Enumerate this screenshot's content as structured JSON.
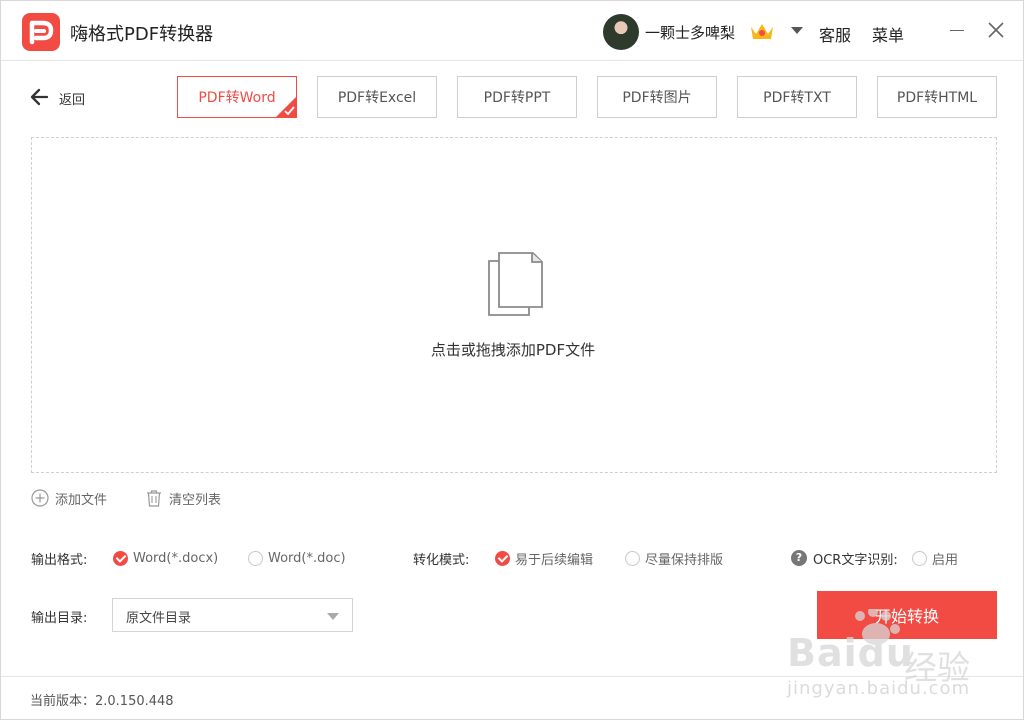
{
  "app": {
    "title": "嗨格式PDF转换器",
    "user_name": "一颗士多啤梨",
    "service": "客服",
    "menu": "菜单",
    "back": "返回"
  },
  "tabs": [
    {
      "label": "PDF转Word",
      "active": true
    },
    {
      "label": "PDF转Excel",
      "active": false
    },
    {
      "label": "PDF转PPT",
      "active": false
    },
    {
      "label": "PDF转图片",
      "active": false
    },
    {
      "label": "PDF转TXT",
      "active": false
    },
    {
      "label": "PDF转HTML",
      "active": false
    }
  ],
  "dropzone": {
    "text": "点击或拖拽添加PDF文件"
  },
  "actions": {
    "add_file": "添加文件",
    "clear_list": "清空列表"
  },
  "options": {
    "output_format_label": "输出格式:",
    "formats": [
      {
        "label": "Word(*.docx)",
        "checked": true
      },
      {
        "label": "Word(*.doc)",
        "checked": false
      }
    ],
    "mode_label": "转化模式:",
    "modes": [
      {
        "label": "易于后续编辑",
        "checked": true
      },
      {
        "label": "尽量保持排版",
        "checked": false
      }
    ],
    "ocr_label": "OCR文字识别:",
    "ocr_enable": "启用",
    "output_dir_label": "输出目录:",
    "output_dir_value": "原文件目录",
    "start_button": "开始转换"
  },
  "footer": {
    "version": "当前版本：2.0.150.448"
  },
  "watermark": {
    "brand": "Baidu",
    "cn": "经验",
    "url": "jingyan.baidu.com"
  },
  "colors": {
    "accent": "#f24b44"
  }
}
